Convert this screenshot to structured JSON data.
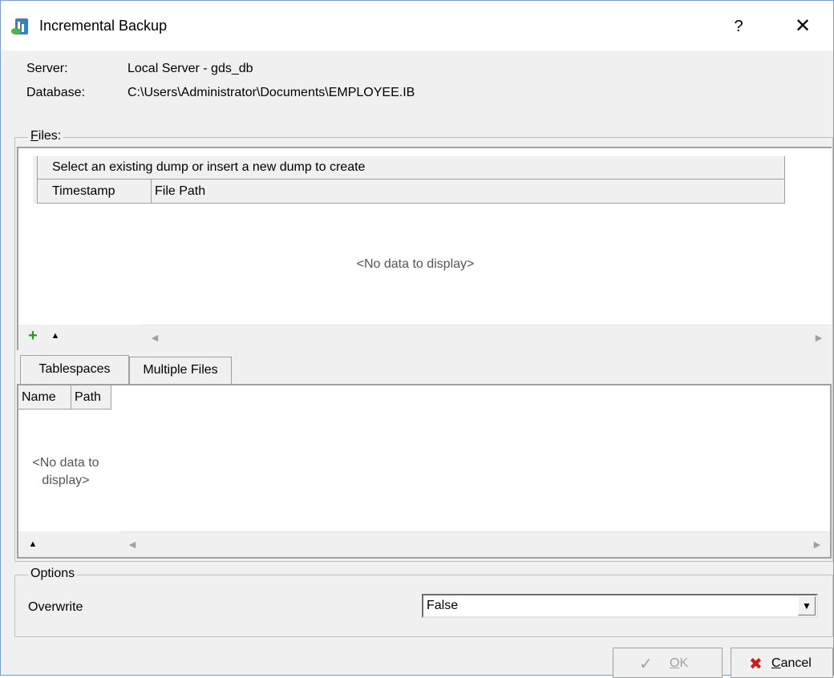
{
  "window": {
    "title": "Incremental Backup",
    "help_label": "?",
    "close_label": "✕"
  },
  "info": {
    "server_label": "Server:",
    "server_value": "Local Server - gds_db",
    "database_label": "Database:",
    "database_value": "C:\\Users\\Administrator\\Documents\\EMPLOYEE.IB"
  },
  "files": {
    "legend_mnemonic": "F",
    "legend_rest": "iles:",
    "group_header": "Select an existing dump or insert a new dump to create",
    "columns": [
      "Timestamp",
      "File Path"
    ],
    "empty_text": "<No data to display>",
    "add_icon": "plus-icon",
    "up_icon": "arrow-up-icon"
  },
  "tabs": {
    "items": [
      "Tablespaces",
      "Multiple Files"
    ],
    "active": "Tablespaces",
    "columns": [
      "Name",
      "Path"
    ],
    "empty_line1": "<No data to",
    "empty_line2": "display>"
  },
  "options": {
    "legend": "Options",
    "overwrite_label": "Overwrite",
    "overwrite_value": "False"
  },
  "buttons": {
    "ok_mnemonic": "O",
    "ok_rest": "K",
    "ok_icon": "checkmark-icon",
    "cancel_mnemonic": "C",
    "cancel_rest": "ancel",
    "cancel_icon": "red-x-icon"
  },
  "colors": {
    "add_green": "#1e9b1e",
    "cancel_red": "#c81e1e",
    "window_border": "#7a9ec9"
  }
}
